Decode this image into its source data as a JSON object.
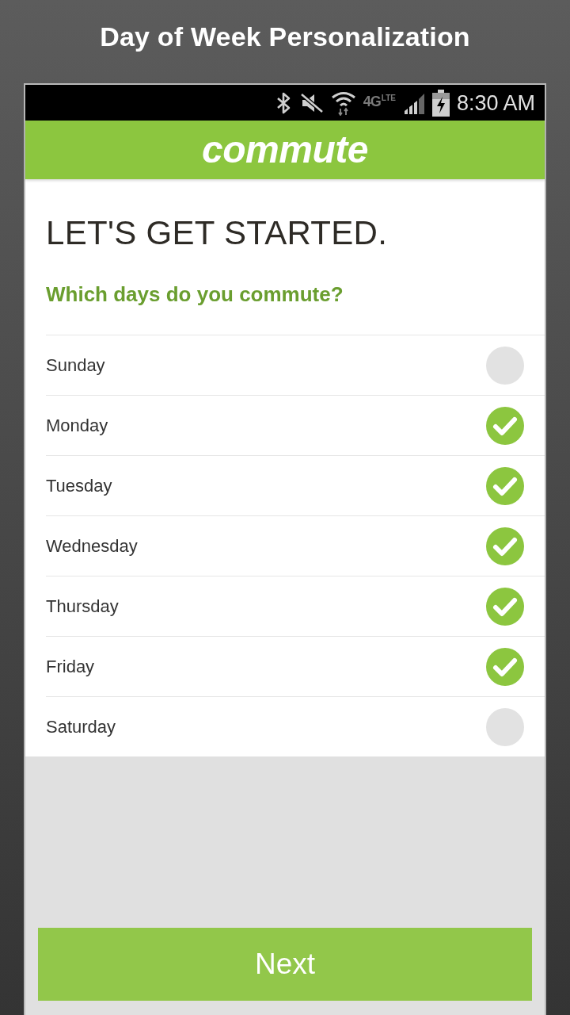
{
  "header_title": "Day of Week Personalization",
  "status_bar": {
    "network": "4G",
    "network_sub": "LTE",
    "time": "8:30 AM"
  },
  "app_bar": {
    "title": "commute"
  },
  "page": {
    "heading": "LET'S GET STARTED.",
    "question": "Which days do you commute?"
  },
  "days": [
    {
      "label": "Sunday",
      "checked": false
    },
    {
      "label": "Monday",
      "checked": true
    },
    {
      "label": "Tuesday",
      "checked": true
    },
    {
      "label": "Wednesday",
      "checked": true
    },
    {
      "label": "Thursday",
      "checked": true
    },
    {
      "label": "Friday",
      "checked": true
    },
    {
      "label": "Saturday",
      "checked": false
    }
  ],
  "next_button": {
    "label": "Next"
  }
}
